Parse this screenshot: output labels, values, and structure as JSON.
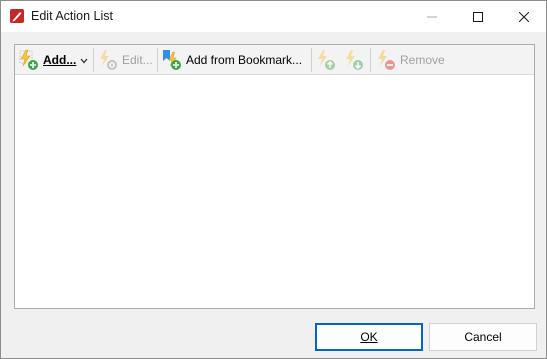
{
  "window": {
    "title": "Edit Action List"
  },
  "toolbar": {
    "add_label": "Add...",
    "edit_label": "Edit...",
    "add_from_bookmark_label": "Add from Bookmark...",
    "remove_label": "Remove"
  },
  "footer": {
    "ok_label": "OK",
    "cancel_label": "Cancel"
  },
  "colors": {
    "accent": "#0067c0",
    "app_icon": "#c62828",
    "disabled_text": "#a0a0a0"
  },
  "icons": {
    "app": "pdf-pen-icon",
    "minimize": "minimize-icon",
    "maximize": "maximize-icon",
    "close": "close-icon",
    "add": "lightning-add-icon",
    "edit": "lightning-gear-icon",
    "bookmark": "bookmark-add-icon",
    "move_up": "lightning-up-icon",
    "move_down": "lightning-down-icon",
    "remove": "lightning-remove-icon"
  }
}
